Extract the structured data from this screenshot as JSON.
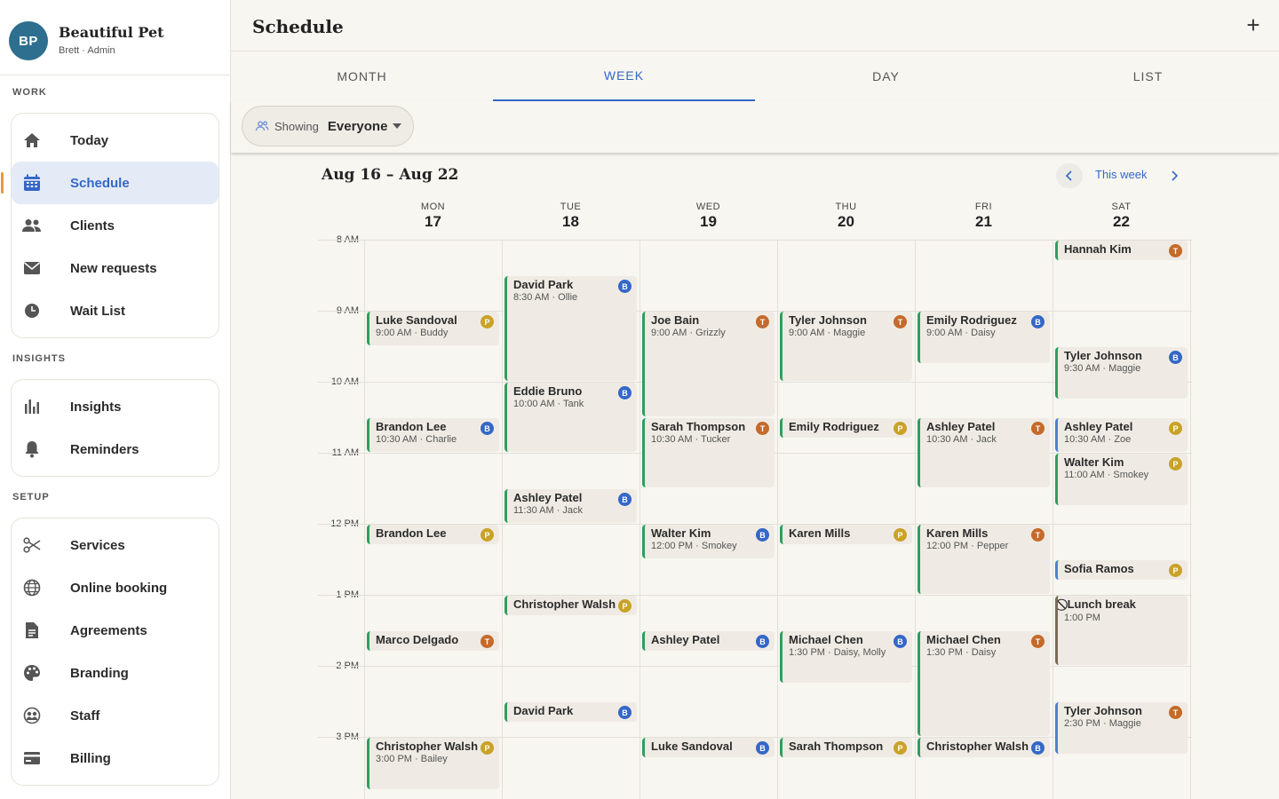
{
  "brand": {
    "initials": "BP",
    "name": "Beautiful Pet",
    "sub": "Brett · Admin"
  },
  "sections": {
    "work": "WORK",
    "insights": "INSIGHTS",
    "setup": "SETUP"
  },
  "nav": {
    "work": [
      {
        "label": "Today",
        "icon": "home-icon"
      },
      {
        "label": "Schedule",
        "icon": "calendar-icon"
      },
      {
        "label": "Clients",
        "icon": "people-icon"
      },
      {
        "label": "New requests",
        "icon": "mail-icon"
      },
      {
        "label": "Wait List",
        "icon": "clock-icon"
      }
    ],
    "insights": [
      {
        "label": "Insights",
        "icon": "bar-chart-icon"
      },
      {
        "label": "Reminders",
        "icon": "bell-icon"
      }
    ],
    "setup": [
      {
        "label": "Services",
        "icon": "scissors-icon"
      },
      {
        "label": "Online booking",
        "icon": "globe-icon"
      },
      {
        "label": "Agreements",
        "icon": "document-icon"
      },
      {
        "label": "Branding",
        "icon": "palette-icon"
      },
      {
        "label": "Staff",
        "icon": "staff-icon"
      },
      {
        "label": "Billing",
        "icon": "card-icon"
      }
    ]
  },
  "header": {
    "title": "Schedule",
    "add_label": "+"
  },
  "tabs": [
    "MONTH",
    "WEEK",
    "DAY",
    "LIST"
  ],
  "filter": {
    "showing": "Showing",
    "value": "Everyone"
  },
  "week": {
    "range": "Aug 16 – Aug 22",
    "this_week": "This week"
  },
  "days": [
    {
      "dow": "MON",
      "num": "17"
    },
    {
      "dow": "TUE",
      "num": "18"
    },
    {
      "dow": "WED",
      "num": "19"
    },
    {
      "dow": "THU",
      "num": "20"
    },
    {
      "dow": "FRI",
      "num": "21"
    },
    {
      "dow": "SAT",
      "num": "22"
    }
  ],
  "hours": [
    "8 AM",
    "9 AM",
    "10 AM",
    "11 AM",
    "12 PM",
    "1 PM",
    "2 PM",
    "3 PM"
  ],
  "colors": {
    "accent": "#3567c7",
    "badge_P": "#c9a227",
    "badge_B": "#3567c7",
    "badge_T": "#c56a2a",
    "stripe": "#2e9e5e"
  },
  "appointments": [
    {
      "day": 0,
      "start": 9.0,
      "end": 9.5,
      "name": "Luke Sandoval",
      "sub": "9:00 AM · Buddy",
      "badge": "P"
    },
    {
      "day": 0,
      "start": 10.5,
      "end": 11.0,
      "name": "Brandon Lee",
      "sub": "10:30 AM · Charlie",
      "badge": "B"
    },
    {
      "day": 0,
      "start": 12.0,
      "end": 12.25,
      "name": "Brandon Lee",
      "sub": "",
      "badge": "P"
    },
    {
      "day": 0,
      "start": 13.5,
      "end": 13.75,
      "name": "Marco Delgado",
      "sub": "",
      "badge": "T"
    },
    {
      "day": 0,
      "start": 15.0,
      "end": 15.75,
      "name": "Christopher Walsh",
      "sub": "3:00 PM · Bailey",
      "badge": "P"
    },
    {
      "day": 1,
      "start": 8.5,
      "end": 10.0,
      "name": "David Park",
      "sub": "8:30 AM · Ollie",
      "badge": "B"
    },
    {
      "day": 1,
      "start": 10.0,
      "end": 11.0,
      "name": "Eddie Bruno",
      "sub": "10:00 AM · Tank",
      "badge": "B"
    },
    {
      "day": 1,
      "start": 11.5,
      "end": 12.0,
      "name": "Ashley Patel",
      "sub": "11:30 AM · Jack",
      "badge": "B"
    },
    {
      "day": 1,
      "start": 13.0,
      "end": 13.25,
      "name": "Christopher Walsh",
      "sub": "",
      "badge": "P"
    },
    {
      "day": 1,
      "start": 14.5,
      "end": 14.75,
      "name": "David Park",
      "sub": "",
      "badge": "B"
    },
    {
      "day": 2,
      "start": 9.0,
      "end": 10.5,
      "name": "Joe Bain",
      "sub": "9:00 AM · Grizzly",
      "badge": "T"
    },
    {
      "day": 2,
      "start": 10.5,
      "end": 11.5,
      "name": "Sarah Thompson",
      "sub": "10:30 AM · Tucker",
      "badge": "T"
    },
    {
      "day": 2,
      "start": 12.0,
      "end": 12.5,
      "name": "Walter Kim",
      "sub": "12:00 PM · Smokey",
      "badge": "B"
    },
    {
      "day": 2,
      "start": 13.5,
      "end": 13.75,
      "name": "Ashley Patel",
      "sub": "",
      "badge": "B"
    },
    {
      "day": 2,
      "start": 15.0,
      "end": 15.25,
      "name": "Luke Sandoval",
      "sub": "",
      "badge": "B"
    },
    {
      "day": 3,
      "start": 9.0,
      "end": 10.0,
      "name": "Tyler Johnson",
      "sub": "9:00 AM · Maggie",
      "badge": "T"
    },
    {
      "day": 3,
      "start": 10.5,
      "end": 10.75,
      "name": "Emily Rodriguez",
      "sub": "",
      "badge": "P"
    },
    {
      "day": 3,
      "start": 12.0,
      "end": 12.25,
      "name": "Karen Mills",
      "sub": "",
      "badge": "P"
    },
    {
      "day": 3,
      "start": 13.5,
      "end": 14.25,
      "name": "Michael Chen",
      "sub": "1:30 PM · Daisy, Molly",
      "badge": "B"
    },
    {
      "day": 3,
      "start": 15.0,
      "end": 15.25,
      "name": "Sarah Thompson",
      "sub": "",
      "badge": "P"
    },
    {
      "day": 4,
      "start": 9.0,
      "end": 9.75,
      "name": "Emily Rodriguez",
      "sub": "9:00 AM · Daisy",
      "badge": "B"
    },
    {
      "day": 4,
      "start": 10.5,
      "end": 11.5,
      "name": "Ashley Patel",
      "sub": "10:30 AM · Jack",
      "badge": "T"
    },
    {
      "day": 4,
      "start": 12.0,
      "end": 13.0,
      "name": "Karen Mills",
      "sub": "12:00 PM · Pepper",
      "badge": "T"
    },
    {
      "day": 4,
      "start": 13.5,
      "end": 15.0,
      "name": "Michael Chen",
      "sub": "1:30 PM · Daisy",
      "badge": "T"
    },
    {
      "day": 4,
      "start": 15.0,
      "end": 15.25,
      "name": "Christopher Walsh",
      "sub": "",
      "badge": "B"
    },
    {
      "day": 5,
      "start": 8.0,
      "end": 8.25,
      "name": "Hannah Kim",
      "sub": "",
      "badge": "T"
    },
    {
      "day": 5,
      "start": 9.5,
      "end": 10.25,
      "name": "Tyler Johnson",
      "sub": "9:30 AM · Maggie",
      "badge": "B"
    },
    {
      "day": 5,
      "start": 10.5,
      "end": 11.0,
      "name": "Ashley Patel",
      "sub": "10:30 AM · Zoe",
      "badge": "P",
      "stripe": "blue"
    },
    {
      "day": 5,
      "start": 11.0,
      "end": 11.75,
      "name": "Walter Kim",
      "sub": "11:00 AM · Smokey",
      "badge": "P"
    },
    {
      "day": 5,
      "start": 12.5,
      "end": 12.75,
      "name": "Sofia Ramos",
      "sub": "",
      "badge": "P",
      "stripe": "blue"
    },
    {
      "day": 5,
      "start": 13.0,
      "end": 14.0,
      "name": "⃠ Lunch break",
      "sub": "1:00 PM",
      "badge": "",
      "blocked": true
    },
    {
      "day": 5,
      "start": 14.5,
      "end": 15.25,
      "name": "Tyler Johnson",
      "sub": "2:30 PM · Maggie",
      "badge": "T",
      "stripe": "blue"
    }
  ]
}
